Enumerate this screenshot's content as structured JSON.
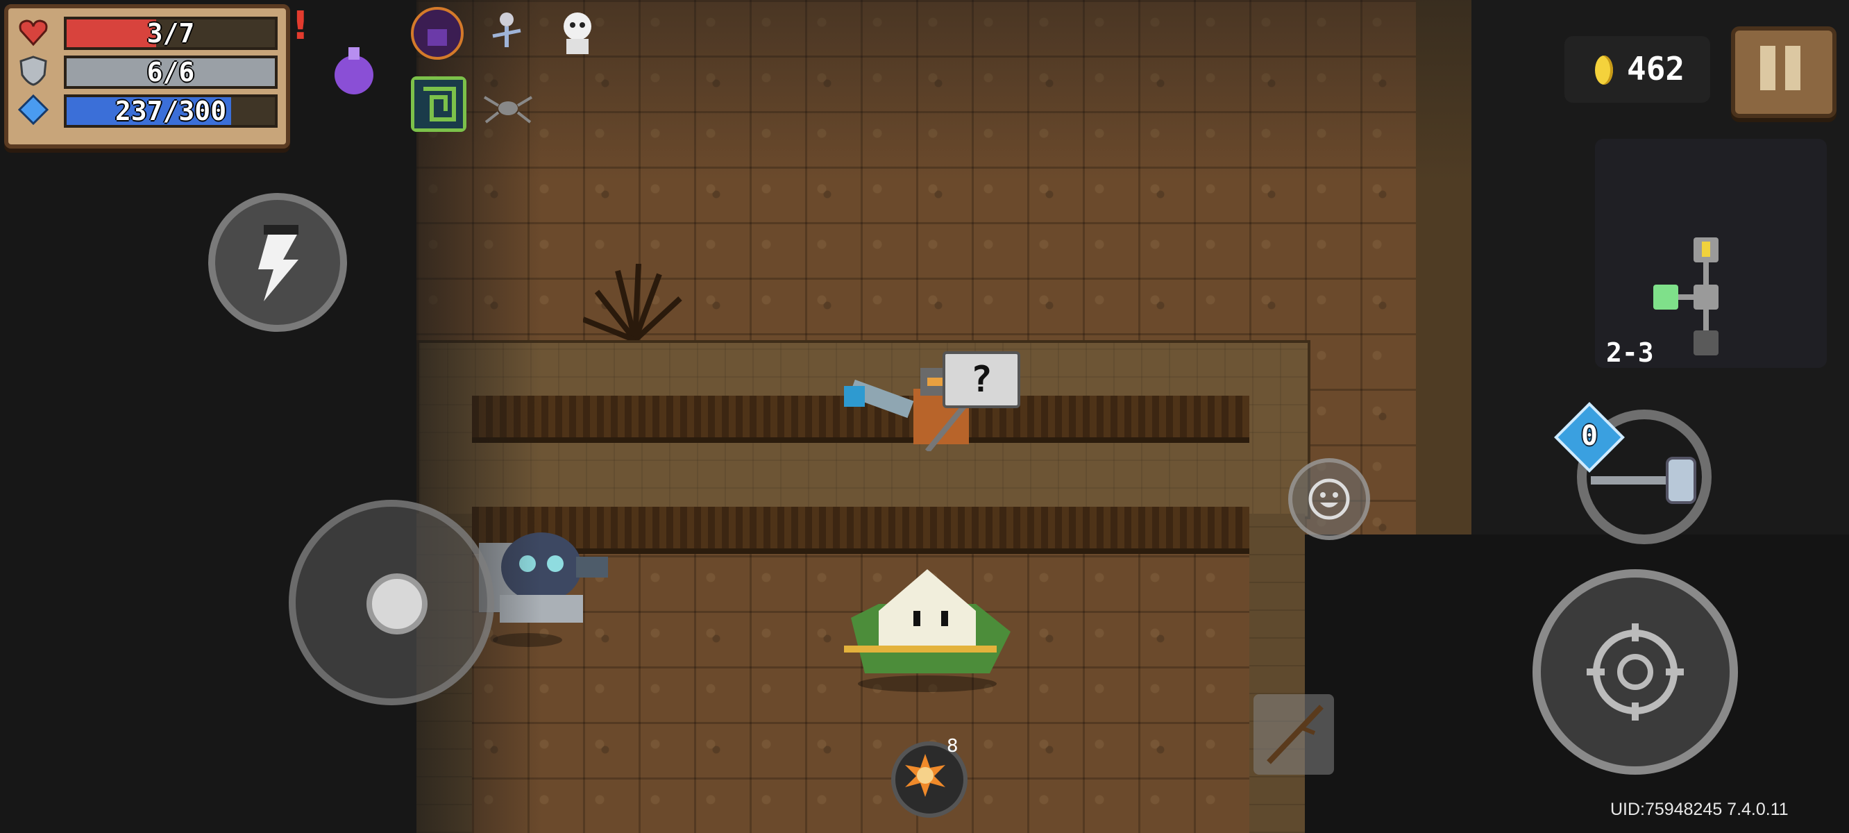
{
  "hud": {
    "health": {
      "label": "3/7",
      "fraction": 0.43,
      "color": "#d8433d"
    },
    "armor": {
      "label": "6/6",
      "fraction": 1.0,
      "color": "#9aa0a6"
    },
    "energy": {
      "label": "237/300",
      "fraction": 0.79,
      "color": "#3b6fd8"
    },
    "alert": "!"
  },
  "buffs": [
    "purple-potion-icon",
    "demon-helmet-icon",
    "dancer-buff-icon",
    "skeleton-buff-icon",
    "maze-buff-icon",
    "spider-buff-icon"
  ],
  "coins": "462",
  "minimap": {
    "level": "2-3"
  },
  "weapon": {
    "energy_cost": "0",
    "name_icon": "hammer-icon"
  },
  "ability": {
    "count": "8"
  },
  "npc": {
    "speech": "?"
  },
  "uid": "UID:75948245 7.4.0.11",
  "colors": {
    "floor": "#6b4a2c",
    "panel": "#c8a57a",
    "coin": "#f4d23c"
  }
}
